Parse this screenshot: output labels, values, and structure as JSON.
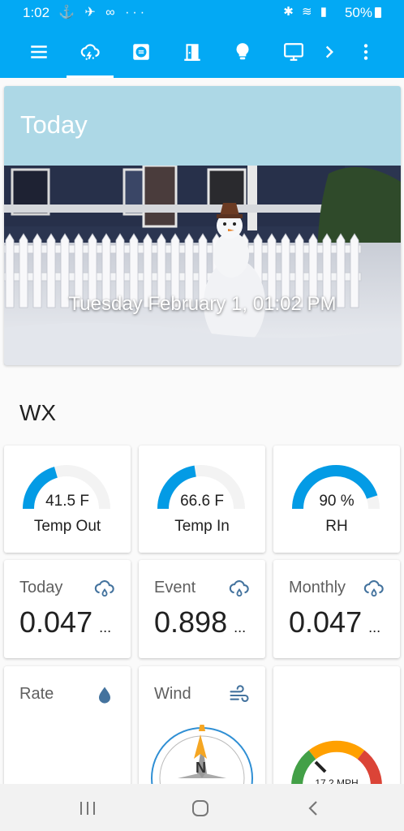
{
  "status_bar": {
    "time": "1:02",
    "notification_icons": "⚓ ✈ ∞ ···",
    "system_icons": "✱ ≋ ▮",
    "battery": "50%"
  },
  "app_bar": {
    "tabs": [
      {
        "icon": "menu-icon"
      },
      {
        "icon": "weather-cloud-lightning-icon",
        "active": true
      },
      {
        "icon": "list-card-icon"
      },
      {
        "icon": "door-icon"
      },
      {
        "icon": "lightbulb-icon"
      },
      {
        "icon": "monitor-icon"
      },
      {
        "icon": "chevron-right-icon"
      },
      {
        "icon": "more-vert-icon"
      }
    ],
    "colors": {
      "primary": "#03a9f4",
      "accent_blue": "#039be5"
    }
  },
  "today": {
    "title": "Today",
    "caption": "Tuesday February 1, 01:02 PM"
  },
  "wx": {
    "title": "WX",
    "gauges": [
      {
        "value": "41.5 F",
        "name": "Temp Out",
        "fraction": 0.41
      },
      {
        "value": "66.6 F",
        "name": "Temp In",
        "fraction": 0.45
      },
      {
        "value": "90 %",
        "name": "RH",
        "fraction": 0.9
      }
    ],
    "sensors": [
      {
        "name": "Today",
        "value": "0.047",
        "more": "...",
        "icon": "weather-pouring-icon"
      },
      {
        "name": "Event",
        "value": "0.898",
        "more": "...",
        "icon": "weather-pouring-icon"
      },
      {
        "name": "Monthly",
        "value": "0.047",
        "more": "...",
        "icon": "weather-pouring-icon"
      }
    ],
    "rate": {
      "name": "Rate",
      "icon": "water-drop-icon"
    },
    "wind": {
      "name": "Wind",
      "icon": "wind-icon",
      "compass_north": "N"
    },
    "wind_speed": {
      "value": "17.2 MPH"
    }
  },
  "nav": {
    "recent": "recent-apps-icon",
    "home": "home-icon",
    "back": "back-icon"
  }
}
